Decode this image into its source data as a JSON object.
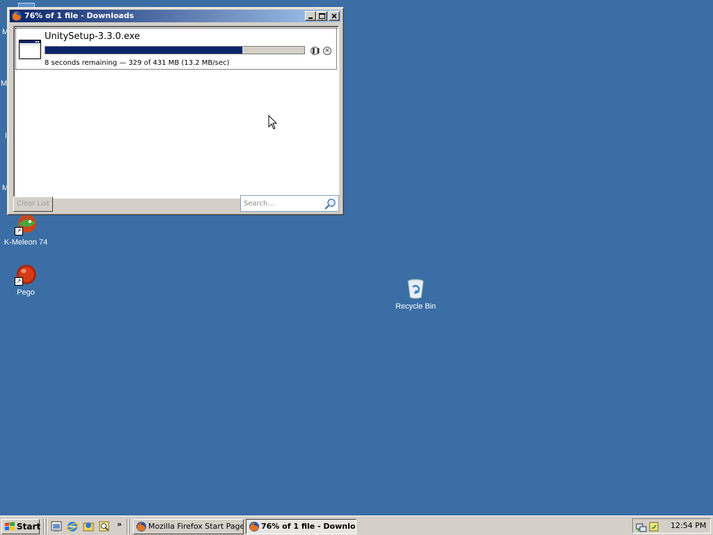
{
  "desktop": {
    "background_color": "#3a6ea5",
    "icons": [
      {
        "label": "K-Meleon 74",
        "icon": "k-meleon-icon"
      },
      {
        "label": "Pego",
        "icon": "pego-icon"
      },
      {
        "label": "Recycle Bin",
        "icon": "recycle-bin-icon"
      }
    ]
  },
  "window": {
    "title": "76% of 1 file - Downloads",
    "title_icon": "firefox-icon",
    "buttons": [
      "minimize",
      "maximize",
      "close"
    ]
  },
  "downloads": [
    {
      "file_name": "UnitySetup-3.3.0.exe",
      "progress": 0.76,
      "status": "8 seconds remaining — 329 of 431 MB (13.2 MB/sec)",
      "actions": [
        "pause-icon",
        "cancel-icon"
      ]
    }
  ],
  "footer": {
    "clear_label": "Clear List",
    "search_placeholder": "Search..."
  },
  "taskbar": {
    "start_label": "Start",
    "quick_launch": [
      "show-desktop-icon",
      "internet-explorer-icon",
      "outlook-icon",
      "explorer-search-icon"
    ],
    "chevron": "»",
    "tasks": [
      {
        "label": "Mozilla Firefox Start Page...",
        "active": false
      },
      {
        "label": "76% of 1 file - Downlo...",
        "active": true
      }
    ],
    "clock": "12:54 PM"
  },
  "colors": {
    "titlebar_start": "#0a246a",
    "titlebar_end": "#a6caf0",
    "progress_fill": "#0a246a",
    "window_face": "#d4d0c8"
  }
}
